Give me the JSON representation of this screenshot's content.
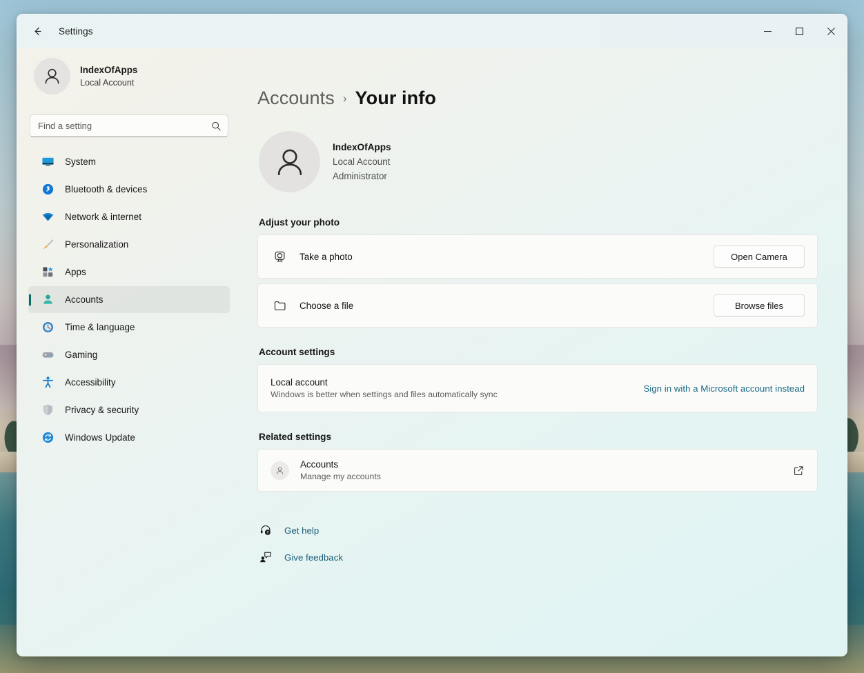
{
  "window": {
    "app_title": "Settings",
    "back_icon": "arrow-left-icon",
    "controls": {
      "minimize": "minimize-icon",
      "maximize": "maximize-icon",
      "close": "close-icon"
    }
  },
  "sidebar": {
    "account": {
      "name": "IndexOfApps",
      "type": "Local Account",
      "avatar_icon": "person-avatar-icon"
    },
    "search": {
      "placeholder": "Find a setting",
      "value": "",
      "icon": "search-icon"
    },
    "items": [
      {
        "label": "System",
        "icon": "monitor-icon",
        "selected": false
      },
      {
        "label": "Bluetooth & devices",
        "icon": "bluetooth-icon",
        "selected": false
      },
      {
        "label": "Network & internet",
        "icon": "wifi-icon",
        "selected": false
      },
      {
        "label": "Personalization",
        "icon": "paintbrush-icon",
        "selected": false
      },
      {
        "label": "Apps",
        "icon": "apps-grid-icon",
        "selected": false
      },
      {
        "label": "Accounts",
        "icon": "person-icon",
        "selected": true
      },
      {
        "label": "Time & language",
        "icon": "clock-globe-icon",
        "selected": false
      },
      {
        "label": "Gaming",
        "icon": "gamepad-icon",
        "selected": false
      },
      {
        "label": "Accessibility",
        "icon": "accessibility-icon",
        "selected": false
      },
      {
        "label": "Privacy & security",
        "icon": "shield-icon",
        "selected": false
      },
      {
        "label": "Windows Update",
        "icon": "update-refresh-icon",
        "selected": false
      }
    ],
    "accent_color": "#0b6a69"
  },
  "main": {
    "breadcrumb": {
      "parent": "Accounts",
      "separator": "›",
      "current": "Your info"
    },
    "profile": {
      "avatar_icon": "person-avatar-icon",
      "name": "IndexOfApps",
      "account_type": "Local Account",
      "role": "Administrator"
    },
    "adjust_photo": {
      "heading": "Adjust your photo",
      "rows": [
        {
          "icon": "camera-icon",
          "title": "Take a photo",
          "button": "Open Camera",
          "button_name": "open-camera-button"
        },
        {
          "icon": "folder-icon",
          "title": "Choose a file",
          "button": "Browse files",
          "button_name": "browse-files-button"
        }
      ]
    },
    "account_settings": {
      "heading": "Account settings",
      "row": {
        "title": "Local account",
        "subtitle": "Windows is better when settings and files automatically sync",
        "link": "Sign in with a Microsoft account instead"
      }
    },
    "related_settings": {
      "heading": "Related settings",
      "row": {
        "icon": "person-small-icon",
        "title": "Accounts",
        "subtitle": "Manage my accounts",
        "external_icon": "external-link-icon"
      }
    },
    "help_links": [
      {
        "label": "Get help",
        "icon": "help-headset-icon"
      },
      {
        "label": "Give feedback",
        "icon": "feedback-person-icon"
      }
    ],
    "link_color": "#1a5e77"
  }
}
